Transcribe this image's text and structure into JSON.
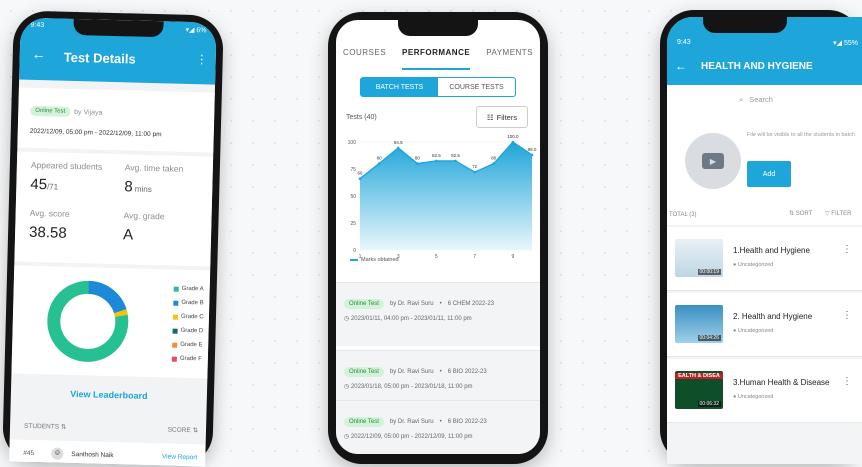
{
  "colors": {
    "accent": "#1ea5d9",
    "donut_green": "#27c092",
    "donut_blue": "#1c8ad6",
    "donut_yellow": "#f1c40f"
  },
  "phone1": {
    "status_time": "9:43",
    "status_icons": "▾◢ 6%",
    "header_title": "Test Details",
    "tag": "Online Test",
    "by": "by Vijaya",
    "date_range": "2022/12/09, 05:00 pm - 2022/12/09, 11:00 pm",
    "stats": [
      {
        "label": "Appeared students",
        "value": "45",
        "sub": "/71"
      },
      {
        "label": "Avg. time taken",
        "value": "8",
        "sub": " mins"
      },
      {
        "label": "Avg. score",
        "value": "38.58",
        "sub": ""
      },
      {
        "label": "Avg. grade",
        "value": "A",
        "sub": ""
      }
    ],
    "grades": [
      "Grade A",
      "Grade B",
      "Grade C",
      "Grade D",
      "Grade E",
      "Grade F"
    ],
    "grade_colors": [
      "#27c092",
      "#1c8ad6",
      "#f1c40f",
      "#0d6b74",
      "#f08a3c",
      "#e74c5b"
    ],
    "view_leaderboard": "View Leaderboard",
    "students_label": "STUDENTS ⇅",
    "score_label": "SCORE ⇅",
    "bottom_rank": "#45",
    "bottom_name": "Santhosh Naik",
    "bottom_link": "View Report"
  },
  "phone2": {
    "tabs": [
      "S",
      "COURSES",
      "PERFORMANCE",
      "PAYMENTS",
      "S"
    ],
    "seg": [
      "BATCH TESTS",
      "COURSE TESTS"
    ],
    "tests_label": "Tests (40)",
    "filters": "Filters",
    "chart_legend": "Marks obtained",
    "items": [
      {
        "tag": "Online Test",
        "by": "by Dr. Ravi Suru",
        "batch": "6 CHEM 2022-23",
        "date": "2023/01/11, 04:00 pm - 2023/01/11, 11:00 pm"
      },
      {
        "tag": "Online Test",
        "by": "by Dr. Ravi Suru",
        "batch": "6 BIO 2022-23",
        "date": "2023/01/18, 05:00 pm - 2023/01/18, 11:00 pm"
      },
      {
        "tag": "Online Test",
        "by": "by Dr. Ravi Suru",
        "batch": "6 BIO 2022-23",
        "date": "2022/12/09, 05:00 pm - 2022/12/09, 11:00 pm"
      }
    ]
  },
  "chart_data": {
    "type": "area",
    "x": [
      1,
      2,
      3,
      4,
      5,
      6,
      7,
      8,
      9,
      10
    ],
    "series": [
      {
        "name": "Marks obtained",
        "values": [
          66,
          80,
          94.5,
          80,
          82.5,
          82.5,
          72,
          80,
          100,
          88
        ]
      }
    ],
    "data_labels": [
      "66",
      "80",
      "94.5",
      "80",
      "82.5",
      "82.5",
      "72",
      "80",
      "100.0",
      "88.0"
    ],
    "x_ticks": [
      "1",
      "3",
      "5",
      "7",
      "9"
    ],
    "y_ticks": [
      "0",
      "25",
      "50",
      "75",
      "100"
    ],
    "ylim": [
      0,
      100
    ],
    "title": "",
    "xlabel": "",
    "ylabel": ""
  },
  "phone3": {
    "status_time": "9:43",
    "status_icons": "▾◢ 55%",
    "header_title": "HEALTH AND HYGIENE",
    "search_placeholder": "Search",
    "upload_note": "File will be visible to all the students in batch",
    "add_label": "Add",
    "total": "TOTAL (3)",
    "sort": "⇅ SORT",
    "filter": "▽ FILTER",
    "videos": [
      {
        "title": "1.Health and Hygiene",
        "category": "Uncategorized",
        "duration": "00:00:19"
      },
      {
        "title": "2. Health and Hygiene",
        "category": "Uncategorized",
        "duration": "00:04:26"
      },
      {
        "title": "3.Human Health & Disease",
        "category": "Uncategorized",
        "duration": "00:06:32",
        "thumb_text": "EALTH & DISEA"
      }
    ]
  }
}
